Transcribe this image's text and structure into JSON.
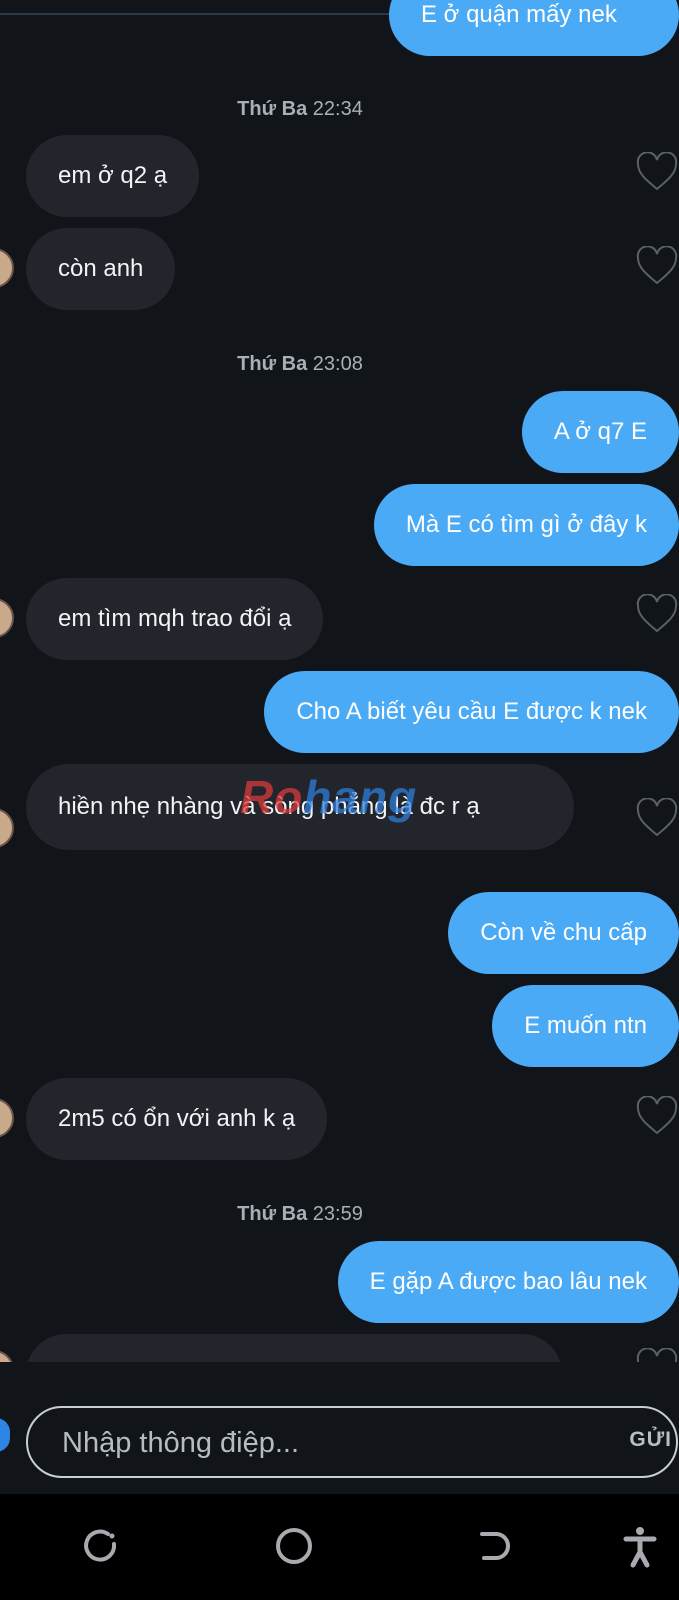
{
  "colors": {
    "background": "#111418",
    "incoming_bubble": "#22262c",
    "outgoing_bubble": "#4aaaf5",
    "timestamp": "#a9afb6"
  },
  "messages": [
    {
      "dir": "out",
      "text": "E ở quận mấy nek"
    },
    {
      "dir": "ts",
      "day": "Thứ Ba",
      "time": "22:34"
    },
    {
      "dir": "in",
      "text": "em ở q2 ạ"
    },
    {
      "dir": "in",
      "text": "còn anh"
    },
    {
      "dir": "ts",
      "day": "Thứ Ba",
      "time": "23:08"
    },
    {
      "dir": "out",
      "text": "A ở q7 E"
    },
    {
      "dir": "out",
      "text": "Mà E có tìm gì ở đây k"
    },
    {
      "dir": "in",
      "text": "em tìm mqh trao đổi ạ"
    },
    {
      "dir": "out",
      "text": "Cho A biết yêu cầu E được k nek"
    },
    {
      "dir": "in",
      "text": "hiền nhẹ nhàng và sòng phẳng là đc r ạ"
    },
    {
      "dir": "out",
      "text": "Còn về chu cấp"
    },
    {
      "dir": "out",
      "text": "E muốn ntn"
    },
    {
      "dir": "in",
      "text": "2m5 có ổn với anh k ạ"
    },
    {
      "dir": "ts",
      "day": "Thứ Ba",
      "time": "23:59"
    },
    {
      "dir": "out",
      "text": "E gặp A được bao lâu nek"
    }
  ],
  "watermark": {
    "part1": "Ro",
    "part2": "hang"
  },
  "composer": {
    "placeholder": "Nhập thông điệp...",
    "send_label": "GỬI"
  },
  "navbar": {
    "icons": [
      "recent-apps-icon",
      "home-icon",
      "back-icon",
      "accessibility-icon"
    ]
  }
}
